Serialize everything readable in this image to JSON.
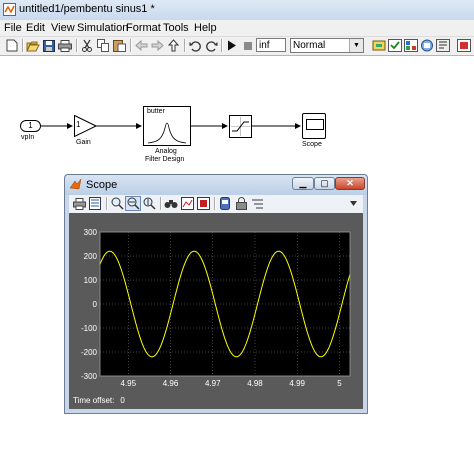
{
  "window": {
    "title": "untitled1/pembentu sinus1 *"
  },
  "menu": [
    "File",
    "Edit",
    "View",
    "Simulation",
    "Format",
    "Tools",
    "Help"
  ],
  "toolbar": {
    "stop_time": "inf",
    "sim_mode": "Normal"
  },
  "model": {
    "inport": {
      "number": "1",
      "label": "vpIn"
    },
    "gain": {
      "value": "1",
      "label": "Gain"
    },
    "filter": {
      "title": "butter",
      "label_line1": "Analog",
      "label_line2": "Filter Design"
    },
    "scope": {
      "label": "Scope"
    }
  },
  "scope_window": {
    "title": "Scope",
    "time_offset_label": "Time offset:",
    "time_offset_value": "0"
  },
  "colors": {
    "trace": "#ffff00",
    "axes_bg": "#000000",
    "grid": "#808080"
  },
  "chart_data": {
    "type": "line",
    "x_ticks": [
      4.95,
      4.96,
      4.97,
      4.98,
      4.99,
      5
    ],
    "y_ticks": [
      300,
      200,
      100,
      0,
      -100,
      -200,
      -300
    ],
    "xlim": [
      4.9433,
      5.0025
    ],
    "ylim": [
      -300,
      300
    ],
    "grid": true,
    "series": [
      {
        "amplitude": 220,
        "frequency_hz": 50,
        "phase_peak_at": 4.9456
      }
    ]
  }
}
